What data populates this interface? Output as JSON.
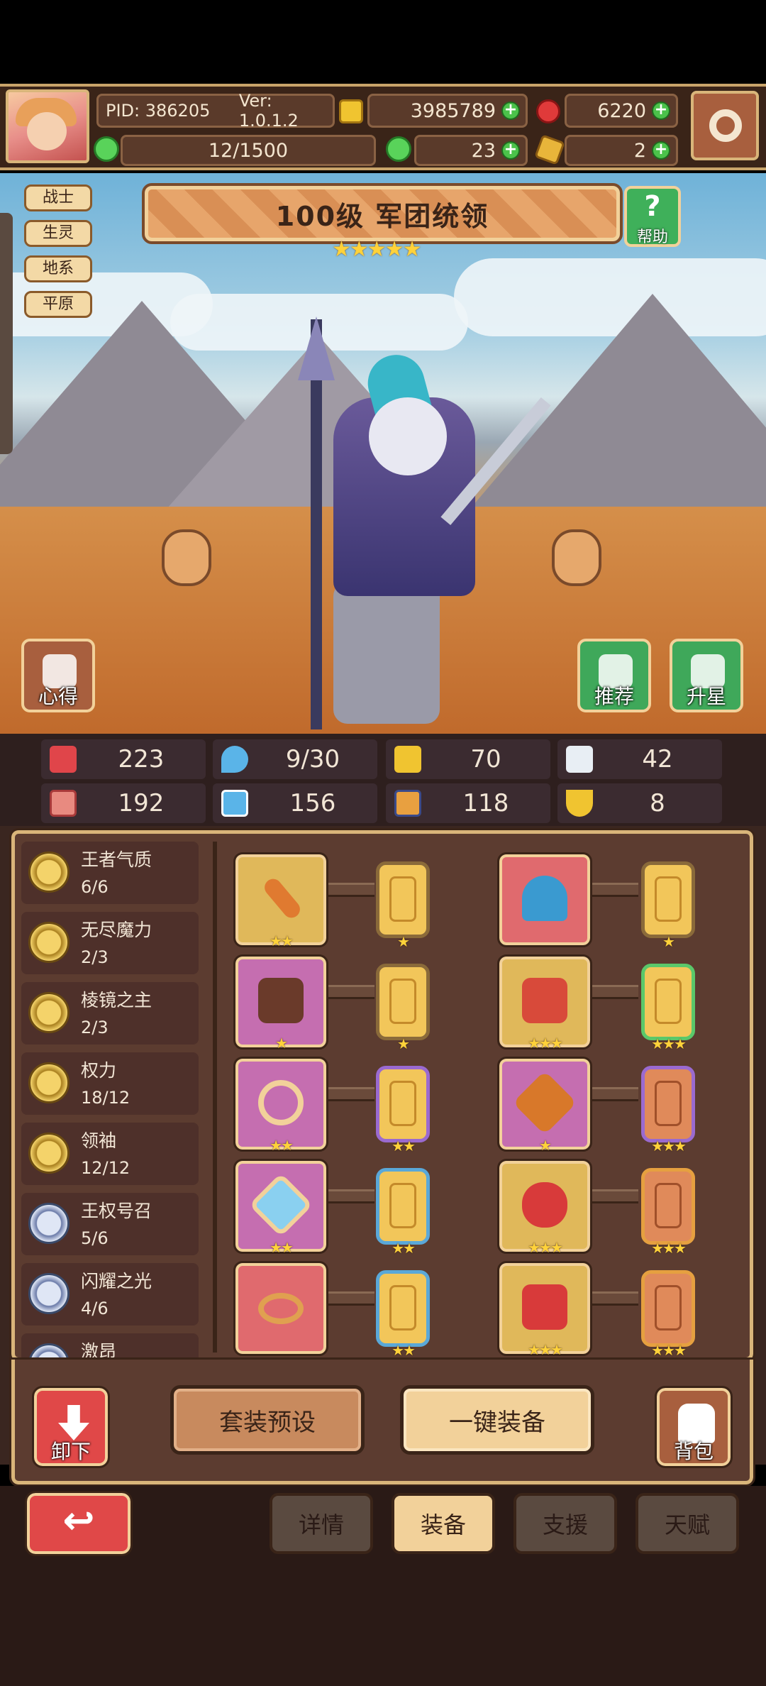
{
  "header": {
    "pid": "PID: 386205",
    "version": "Ver: 1.0.1.2",
    "gold": "3985789",
    "gems": "6220",
    "stamina": "12/1500",
    "clovers": "23",
    "keys": "2"
  },
  "tags": [
    "战士",
    "生灵",
    "地系",
    "平原"
  ],
  "hero": {
    "title": "100级  军团统领",
    "stars": "★★★★★",
    "help_label": "帮助"
  },
  "scene_buttons": {
    "xinde": "心得",
    "tuijian": "推荐",
    "shengxing": "升星"
  },
  "stats": [
    "223",
    "9/30",
    "70",
    "42",
    "192",
    "156",
    "118",
    "8"
  ],
  "sets": [
    {
      "name": "王者气质",
      "progress": "6/6"
    },
    {
      "name": "无尽魔力",
      "progress": "2/3"
    },
    {
      "name": "棱镜之主",
      "progress": "2/3"
    },
    {
      "name": "权力",
      "progress": "18/12"
    },
    {
      "name": "领袖",
      "progress": "12/12"
    },
    {
      "name": "王权号召",
      "progress": "5/6"
    },
    {
      "name": "闪耀之光",
      "progress": "4/6"
    },
    {
      "name": "激昂",
      "progress": ""
    }
  ],
  "equipment_stars": {
    "s2": "★★",
    "s1": "★",
    "s3": "★★★"
  },
  "actions": {
    "unequip": "卸下",
    "preset": "套装预设",
    "auto_equip": "一键装备",
    "bag": "背包"
  },
  "nav": {
    "back": "↩",
    "tabs": [
      "详情",
      "装备",
      "支援",
      "天赋"
    ]
  }
}
